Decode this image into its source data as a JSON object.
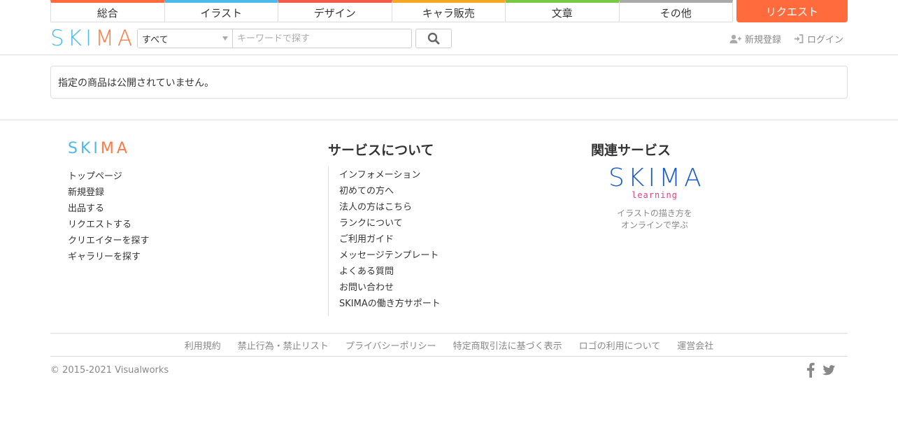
{
  "nav": {
    "categories": [
      {
        "label": "総合",
        "color": "#ff6b3d"
      },
      {
        "label": "イラスト",
        "color": "#4cb9e8"
      },
      {
        "label": "デザイン",
        "color": "#f25a4a"
      },
      {
        "label": "キャラ販売",
        "color": "#f5a623"
      },
      {
        "label": "文章",
        "color": "#7ac943"
      },
      {
        "label": "その他",
        "color": "#aaaaaa"
      }
    ],
    "request_label": "リクエスト"
  },
  "header": {
    "logo_text": "SKIMA",
    "search": {
      "category_value": "すべて",
      "keyword_placeholder": "キーワードで探す"
    },
    "register_label": "新規登録",
    "login_label": "ログイン"
  },
  "main": {
    "message": "指定の商品は公開されていません。"
  },
  "footer": {
    "logo_text": "SKIMA",
    "col1_links": [
      "トップページ",
      "新規登録",
      "出品する",
      "リクエストする",
      "クリエイターを探す",
      "ギャラリーを探す"
    ],
    "col2_title": "サービスについて",
    "col2_links": [
      "インフォメーション",
      "初めての方へ",
      "法人の方はこちら",
      "ランクについて",
      "ご利用ガイド",
      "メッセージテンプレート",
      "よくある質問",
      "お問い合わせ",
      "SKIMAの働き方サポート"
    ],
    "col3_title": "関連サービス",
    "learning": {
      "logo_text": "SKIMA",
      "logo_sub": "learning",
      "desc_line1": "イラストの描き方を",
      "desc_line2": "オンラインで学ぶ"
    },
    "legal_links": [
      "利用規約",
      "禁止行為・禁止リスト",
      "プライバシーポリシー",
      "特定商取引法に基づく表示",
      "ロゴの利用について",
      "運営会社"
    ],
    "copyright": "© 2015-2021 Visualworks",
    "social": [
      "facebook-icon",
      "twitter-icon"
    ]
  }
}
